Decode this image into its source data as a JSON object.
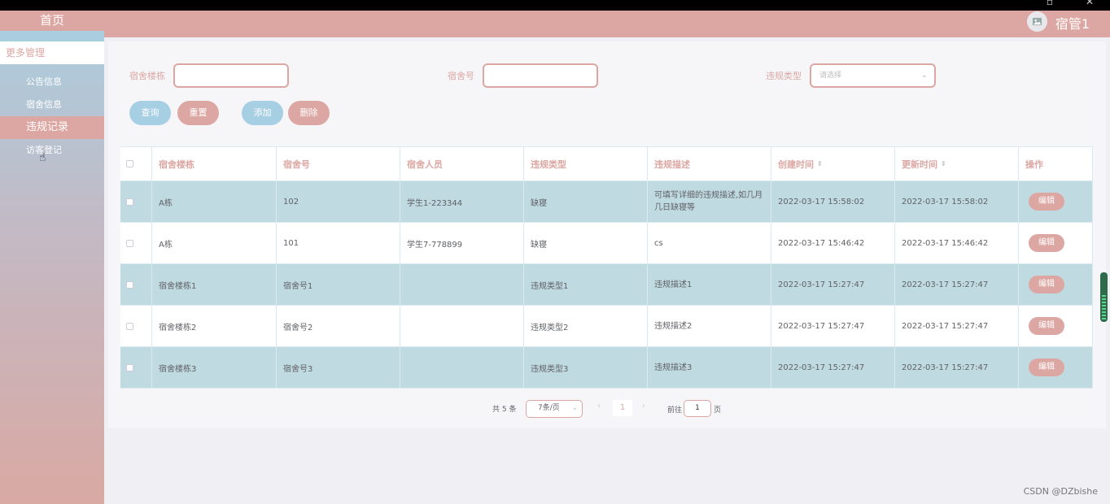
{
  "sidebar": {
    "home": "首页",
    "section": "更多管理",
    "items": [
      {
        "label": "公告信息"
      },
      {
        "label": "宿舍信息"
      },
      {
        "label": "违规记录"
      },
      {
        "label": "访客登记"
      }
    ]
  },
  "header": {
    "user": "宿管1"
  },
  "search": {
    "building_label": "宿舍楼栋",
    "room_label": "宿舍号",
    "type_label": "违规类型",
    "type_placeholder": "请选择"
  },
  "buttons": {
    "query": "查询",
    "reset": "重置",
    "add": "添加",
    "delete": "删除"
  },
  "table": {
    "headers": [
      "宿舍楼栋",
      "宿舍号",
      "宿舍人员",
      "违规类型",
      "违规描述",
      "创建时间",
      "更新时间",
      "操作"
    ],
    "edit_label": "编辑",
    "rows": [
      {
        "building": "A栋",
        "room": "102",
        "members": "学生1-223344",
        "type": "缺寝",
        "desc": "可填写详细的违规描述,如几月几日缺寝等",
        "created": "2022-03-17 15:58:02",
        "updated": "2022-03-17 15:58:02"
      },
      {
        "building": "A栋",
        "room": "101",
        "members": "学生7-778899",
        "type": "缺寝",
        "desc": "cs",
        "created": "2022-03-17 15:46:42",
        "updated": "2022-03-17 15:46:42"
      },
      {
        "building": "宿舍楼栋1",
        "room": "宿舍号1",
        "members": "",
        "type": "违规类型1",
        "desc": "违规描述1",
        "created": "2022-03-17 15:27:47",
        "updated": "2022-03-17 15:27:47"
      },
      {
        "building": "宿舍楼栋2",
        "room": "宿舍号2",
        "members": "",
        "type": "违规类型2",
        "desc": "违规描述2",
        "created": "2022-03-17 15:27:47",
        "updated": "2022-03-17 15:27:47"
      },
      {
        "building": "宿舍楼栋3",
        "room": "宿舍号3",
        "members": "",
        "type": "违规类型3",
        "desc": "违规描述3",
        "created": "2022-03-17 15:27:47",
        "updated": "2022-03-17 15:27:47"
      }
    ]
  },
  "pagination": {
    "total": "共 5 条",
    "page_size": "7条/页",
    "current_page": "1",
    "goto_prefix": "前往",
    "goto_value": "1",
    "goto_suffix": "页"
  },
  "watermark": "CSDN @DZbishe",
  "colors": {
    "accent_pink": "#dca7a3",
    "accent_blue": "#a7cfe4",
    "row_tint": "#bfdae0"
  }
}
